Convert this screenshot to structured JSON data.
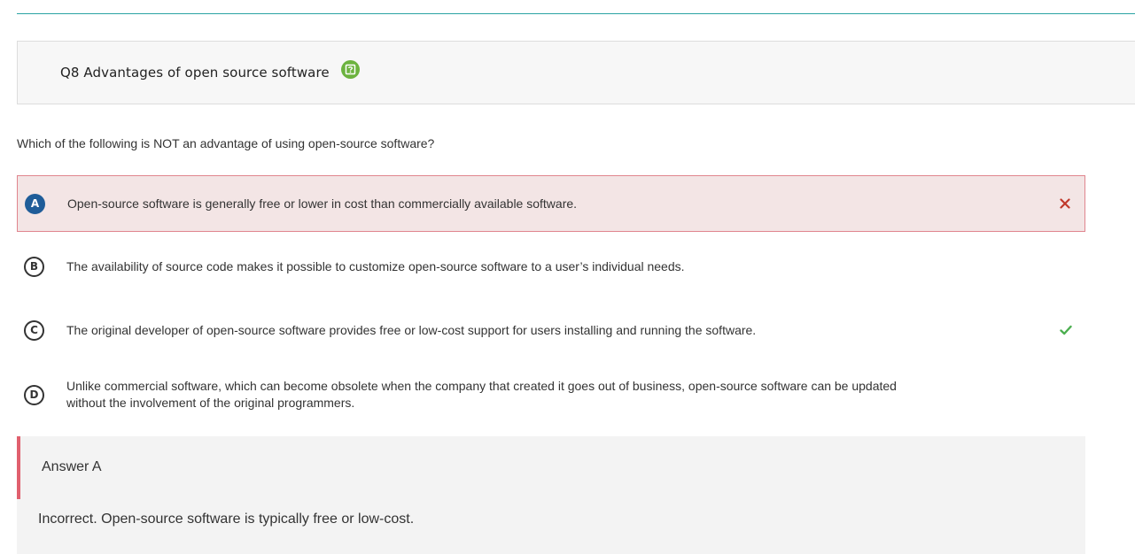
{
  "question": {
    "title": "Q8 Advantages of open source software",
    "help_icon": "help-icon",
    "text": "Which of the following is NOT an advantage of using open-source software?"
  },
  "options": [
    {
      "letter": "A",
      "text": "Open-source software is generally free or lower in cost than commercially available software.",
      "state": "selected-incorrect",
      "mark_icon": "x-icon"
    },
    {
      "letter": "B",
      "text": "The availability of source code makes it possible to customize open-source software to a user’s individual needs.",
      "state": "none"
    },
    {
      "letter": "C",
      "text": "The original developer of open-source software provides free or low-cost support for users installing and running the software.",
      "state": "correct",
      "mark_icon": "check-icon"
    },
    {
      "letter": "D",
      "text": "Unlike commercial software, which can become obsolete when the company that created it goes out of business, open-source software can be updated without the involvement of the original programmers.",
      "state": "none"
    }
  ],
  "answer": {
    "title": "Answer A",
    "feedback": "Incorrect. Open-source software is typically free or low-cost."
  },
  "colors": {
    "accent_rule": "#2aa3a3",
    "help_icon": "#6cb33f",
    "incorrect": "#c0392b",
    "incorrect_bg": "#f3e5e5",
    "correct": "#4caf50",
    "selected_letter": "#1f5d99"
  }
}
